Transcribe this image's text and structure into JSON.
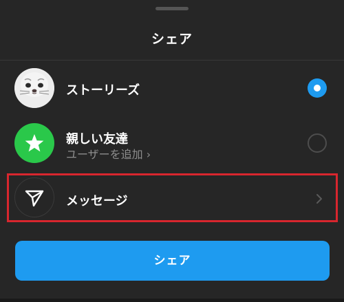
{
  "sheet": {
    "title": "シェア"
  },
  "options": [
    {
      "label": "ストーリーズ",
      "selected": true,
      "avatar_icon": "seal-avatar-icon"
    },
    {
      "label": "親しい友達",
      "sublabel": "ユーザーを追加 ›",
      "selected": false,
      "avatar_icon": "star-icon"
    },
    {
      "label": "メッセージ",
      "avatar_icon": "paper-plane-icon",
      "trailing_icon": "chevron-right-icon"
    }
  ],
  "share_button": {
    "label": "シェア"
  },
  "colors": {
    "background": "#262626",
    "accent": "#1e9bf0",
    "close_friends": "#2ac84a",
    "highlight": "#d8262e"
  }
}
